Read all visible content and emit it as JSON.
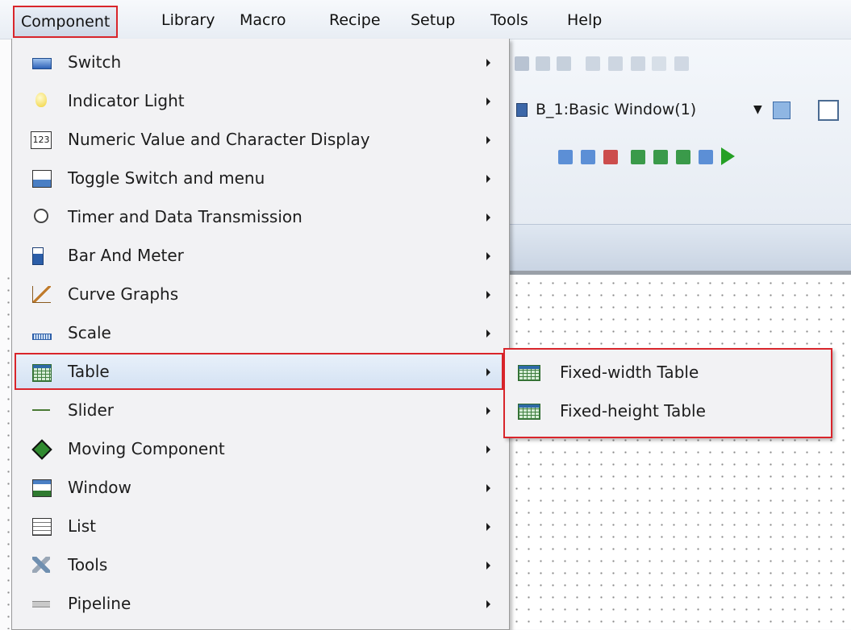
{
  "menubar": {
    "items": [
      "Component",
      "Library",
      "Macro",
      "Recipe",
      "Setup",
      "Tools",
      "Help"
    ]
  },
  "toolbar": {
    "window_select": "B_1:Basic Window(1)"
  },
  "component_menu": {
    "items": [
      {
        "label": "Switch",
        "icon": "switch-icon"
      },
      {
        "label": "Indicator Light",
        "icon": "bulb-icon"
      },
      {
        "label": "Numeric Value and Character Display",
        "icon": "numeric-icon",
        "icon_text": "123"
      },
      {
        "label": "Toggle Switch and menu",
        "icon": "toggle-icon"
      },
      {
        "label": "Timer and Data Transmission",
        "icon": "clock-icon"
      },
      {
        "label": "Bar And Meter",
        "icon": "bar-meter-icon"
      },
      {
        "label": "Curve Graphs",
        "icon": "curve-icon"
      },
      {
        "label": "Scale",
        "icon": "scale-icon"
      },
      {
        "label": "Table",
        "icon": "table-icon",
        "selected": true
      },
      {
        "label": "Slider",
        "icon": "slider-icon"
      },
      {
        "label": "Moving Component",
        "icon": "move-icon"
      },
      {
        "label": "Window",
        "icon": "window-icon"
      },
      {
        "label": "List",
        "icon": "list-icon"
      },
      {
        "label": "Tools",
        "icon": "tools-icon"
      },
      {
        "label": "Pipeline",
        "icon": "pipeline-icon"
      }
    ]
  },
  "table_submenu": {
    "items": [
      {
        "label": "Fixed-width Table",
        "icon": "fixed-width-table-icon"
      },
      {
        "label": "Fixed-height Table",
        "icon": "fixed-height-table-icon"
      }
    ]
  },
  "colors": {
    "highlight_border": "#d9252b",
    "selection_bg": "#d4e2f3"
  }
}
